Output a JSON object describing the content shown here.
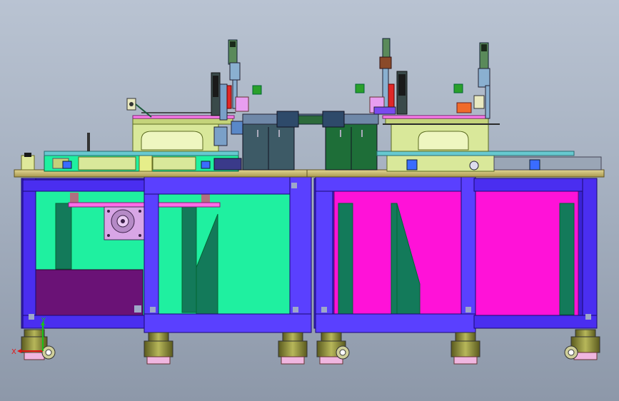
{
  "viewport": {
    "background_top": "#b9c3d2",
    "background_bottom": "#8d98a9"
  },
  "palette": {
    "frame": "#4a2ef0",
    "frame_dark": "#2a14a8",
    "tabletop": "#cbbd74",
    "panel_green": "#1ff0a0",
    "panel_magenta": "#ff12d8",
    "panel_purple": "#6a1276",
    "slab_green": "#137a5a",
    "cabinet_blue": "#3d5a66",
    "cabinet_green": "#1e6e38",
    "module_yellow": "#d9e89a",
    "rail_cyan": "#67c9d0",
    "caster_olive": "#8a8a34",
    "caster_pink": "#f0b6e0"
  },
  "coordinate_axes": {
    "x_label": "X",
    "y_label": "Y",
    "x_color": "#e01818",
    "y_color": "#18c018"
  }
}
